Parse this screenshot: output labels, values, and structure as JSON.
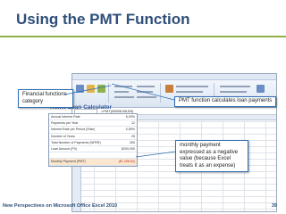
{
  "slide": {
    "title": "Using the PMT Function",
    "footer_left": "New Perspectives on Microsoft Office Excel 2010",
    "page_number": "39",
    "accent_color": "#8fb24b",
    "title_color": "#2f4f7a"
  },
  "excel": {
    "formula": "=PMT(B5/B6,B8,B9)",
    "sheet_title": "Home Loan Calculator",
    "rows": [
      {
        "label": "Annual Interest Rate",
        "value": "6.00%"
      },
      {
        "label": "Payments per Year",
        "value": "12"
      },
      {
        "label": "Interest Rate per Period (Rate)",
        "value": "0.50%"
      },
      {
        "label": "Number of Years",
        "value": "25"
      },
      {
        "label": "Total Number of Payments (NPER)",
        "value": "300"
      },
      {
        "label": "Loan Amount (PV)",
        "value": "$200,000"
      },
      {
        "label": "",
        "value": ""
      },
      {
        "label": "Monthly Payment (PMT)",
        "value": "($1,288.60)"
      }
    ]
  },
  "callouts": {
    "financial": "Financial functions category",
    "pmt": "PMT function calculates loan payments",
    "negative": "monthly payment expressed as a negative value (because Excel treats it as an expense)"
  }
}
